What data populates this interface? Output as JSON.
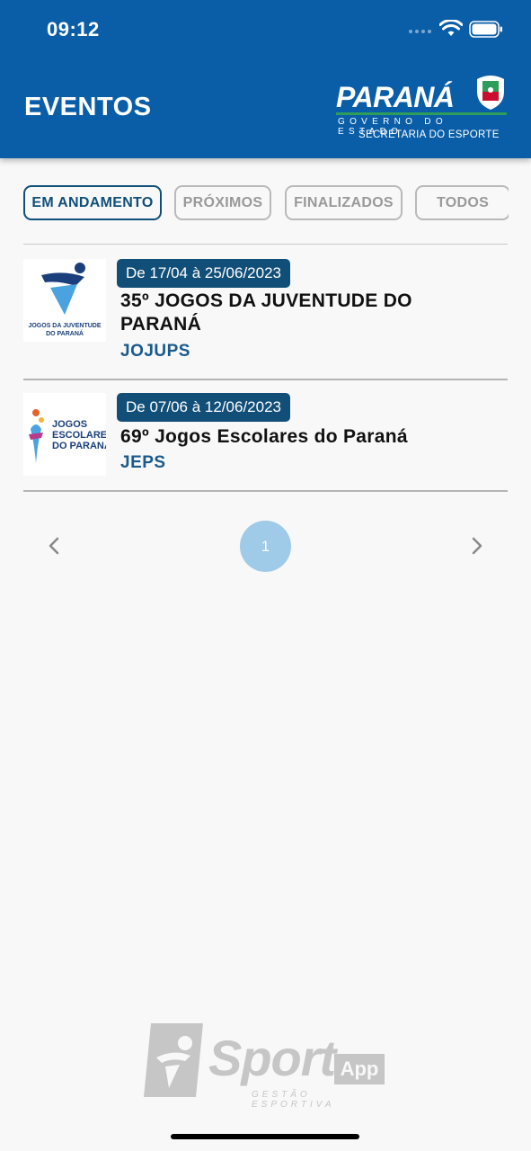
{
  "status_bar": {
    "time": "09:12"
  },
  "header": {
    "title": "EVENTOS",
    "logo": {
      "word": "PARANÁ",
      "gov": "GOVERNO DO ESTADO",
      "secretaria": "SECRETARIA DO ESPORTE"
    },
    "color": "#0a5ea8"
  },
  "filters": {
    "tabs": [
      {
        "label": "EM ANDAMENTO",
        "active": true
      },
      {
        "label": "PRÓXIMOS",
        "active": false
      },
      {
        "label": "FINALIZADOS",
        "active": false
      },
      {
        "label": "TODOS",
        "active": false
      }
    ]
  },
  "events": [
    {
      "date": "De 17/04 à 25/06/2023",
      "name": "35º JOGOS DA JUVENTUDE DO PARANÁ",
      "abbr": "JOJUPS",
      "thumb_text": "JOGOS DA JUVENTUDE DO PARANÁ"
    },
    {
      "date": "De 07/06 à 12/06/2023",
      "name": "69º Jogos Escolares do Paraná",
      "abbr": "JEPS",
      "thumb_text": "JOGOS ESCOLARES DO PARANÁ"
    }
  ],
  "pagination": {
    "current_page": "1"
  },
  "watermark": {
    "word": "Sport",
    "app": "App",
    "tagline": "GESTÃO ESPORTIVA"
  },
  "colors": {
    "accent": "#124f78",
    "page_bubble": "#9fcae8",
    "abbr": "#1a5a8c"
  }
}
